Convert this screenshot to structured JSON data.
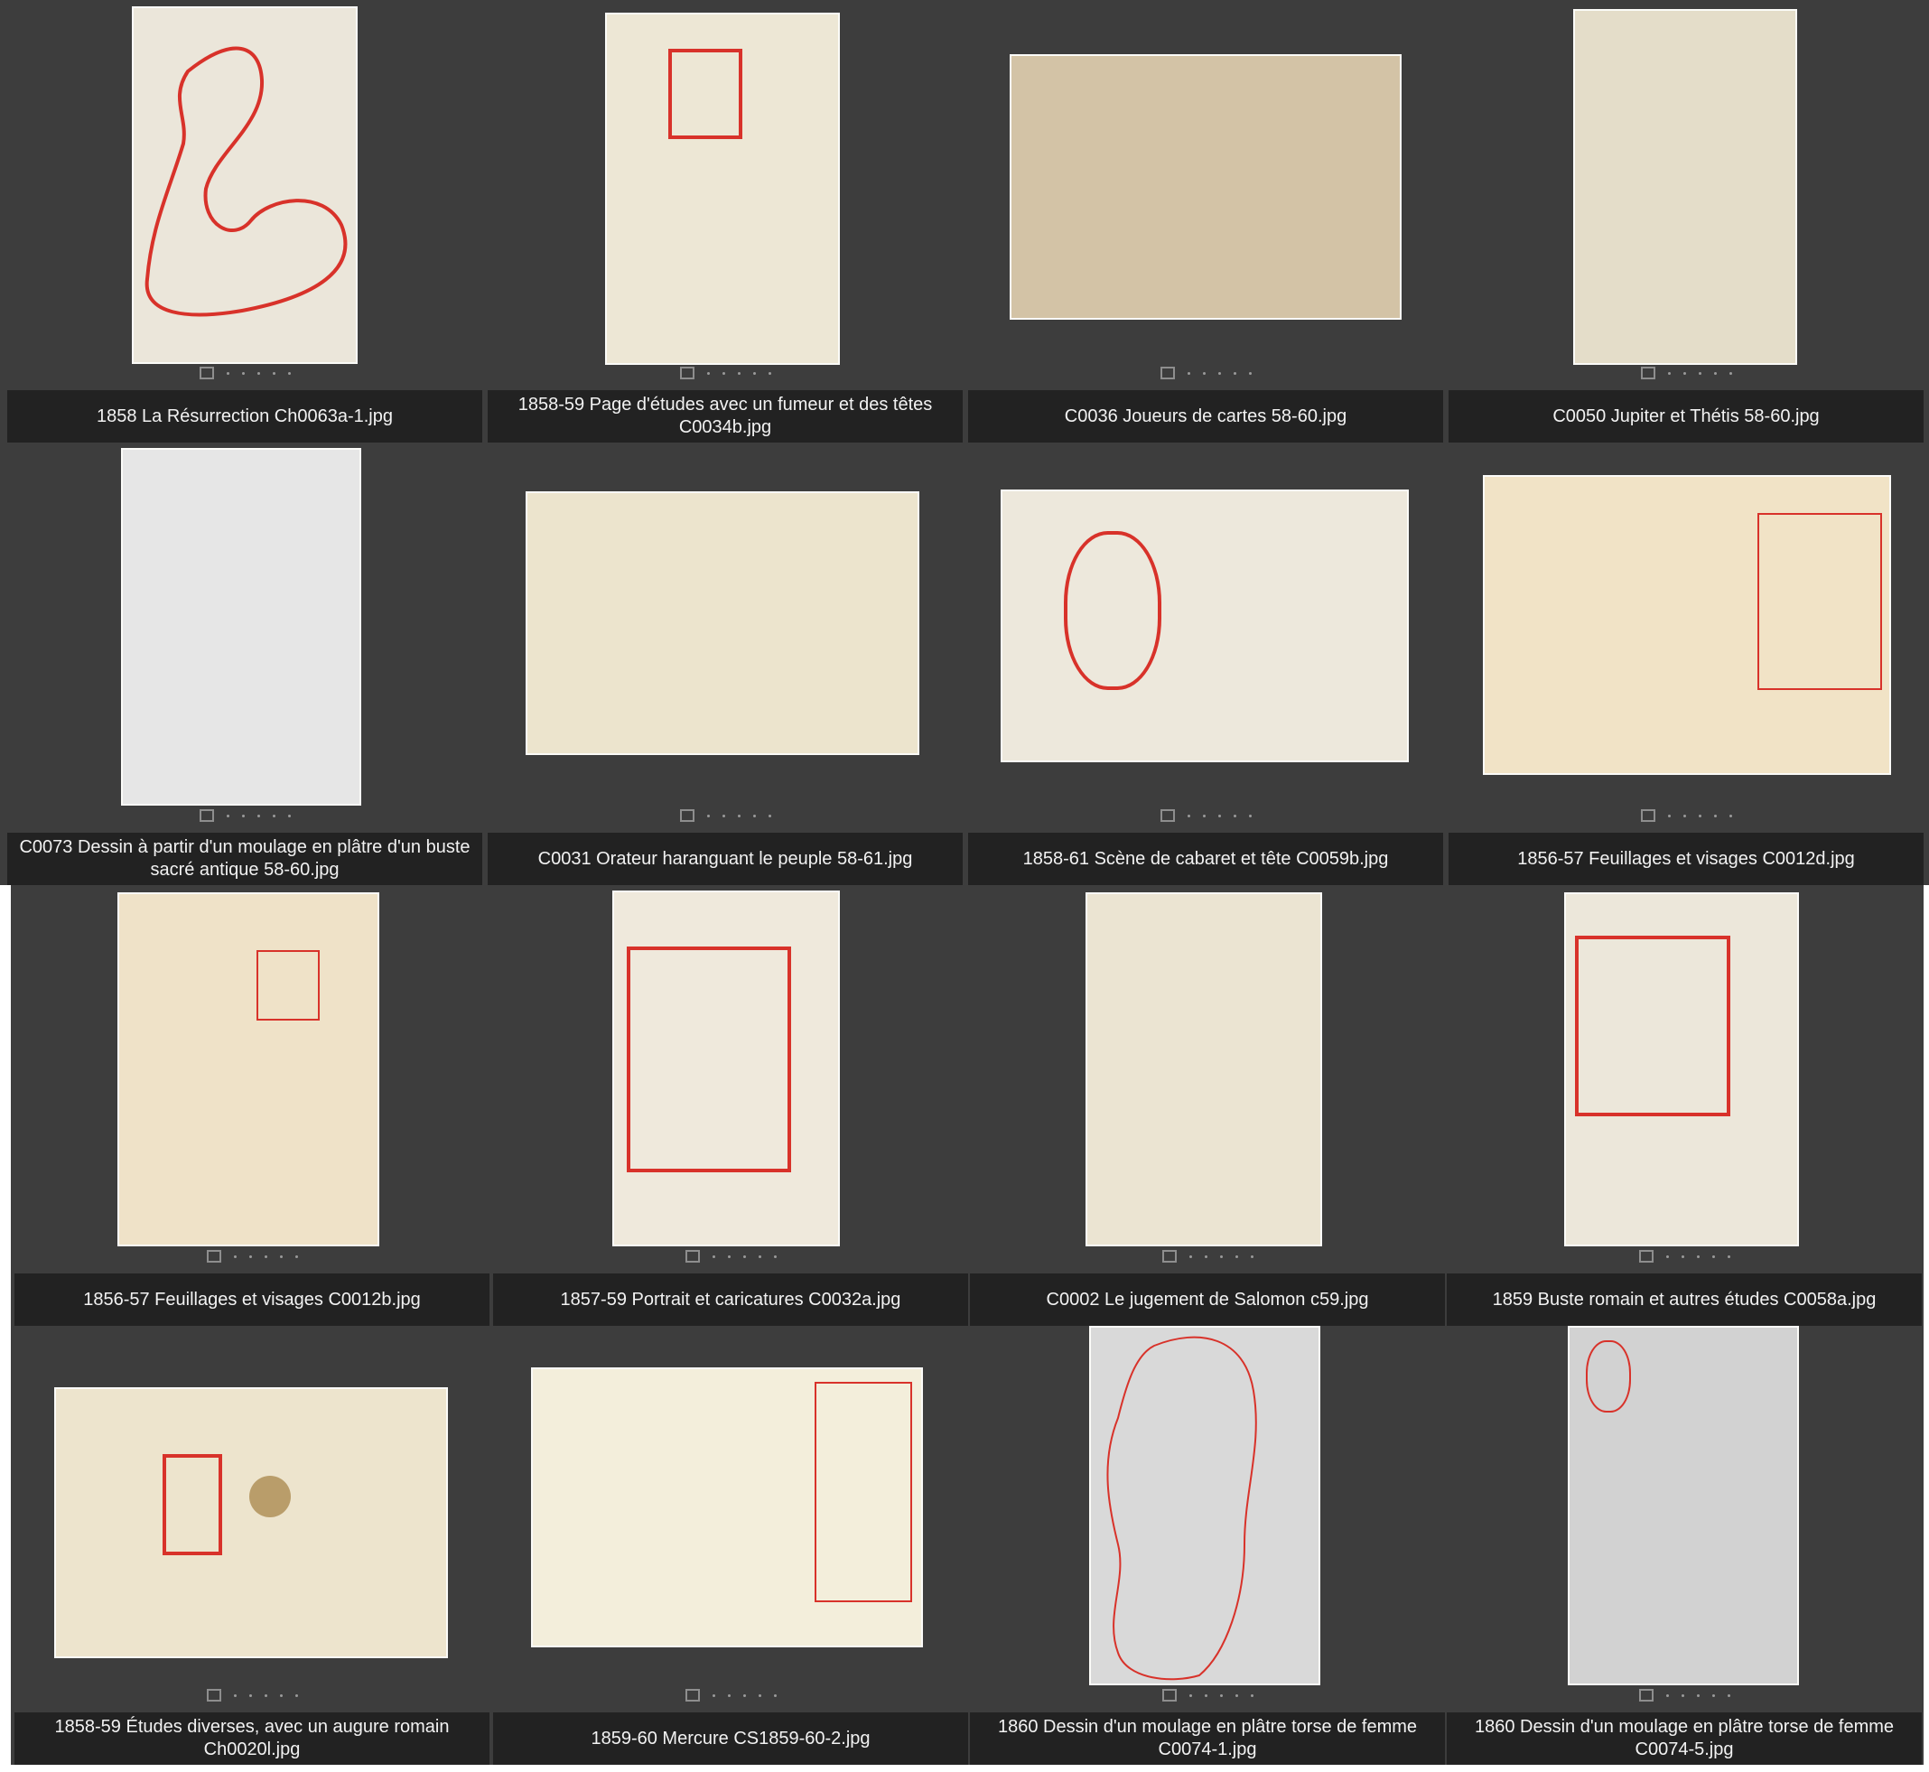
{
  "grid": {
    "items": [
      {
        "label": "1858 La Résurrection Ch0063a-1.jpg",
        "tone": "#ebe6da"
      },
      {
        "label": "1858-59 Page d'études avec un fumeur et des têtes C0034b.jpg",
        "tone": "#ede7d5"
      },
      {
        "label": "C0036 Joueurs de cartes 58-60.jpg",
        "tone": "#d3c3a6"
      },
      {
        "label": "C0050 Jupiter et Thétis 58-60.jpg",
        "tone": "#e4ddc9"
      },
      {
        "label": "C0073 Dessin à partir d'un moulage en plâtre d'un buste sacré antique 58-60.jpg",
        "tone": "#e6e6e6"
      },
      {
        "label": "C0031 Orateur haranguant le peuple 58-61.jpg",
        "tone": "#ece4cd"
      },
      {
        "label": "1858-61 Scène de cabaret et tête C0059b.jpg",
        "tone": "#ede8dc"
      },
      {
        "label": "1856-57 Feuillages et visages C0012d.jpg",
        "tone": "#f1e3c6"
      },
      {
        "label": "1856-57 Feuillages et visages C0012b.jpg",
        "tone": "#efe2c8"
      },
      {
        "label": "1857-59 Portrait et caricatures C0032a.jpg",
        "tone": "#efe9dc"
      },
      {
        "label": "C0002 Le jugement de Salomon c59.jpg",
        "tone": "#ebe4d2"
      },
      {
        "label": "1859 Buste romain et autres études C0058a.jpg",
        "tone": "#ece7da"
      },
      {
        "label": "1858-59 Études diverses, avec un augure romain Ch0020l.jpg",
        "tone": "#ede4cd"
      },
      {
        "label": "1859-60 Mercure CS1859-60-2.jpg",
        "tone": "#f3eedb"
      },
      {
        "label": "1860 Dessin d'un moulage en plâtre torse de femme C0074-1.jpg",
        "tone": "#d9d9d9"
      },
      {
        "label": "1860 Dessin d'un moulage en plâtre torse de femme C0074-5.jpg",
        "tone": "#d2d2d2"
      }
    ]
  }
}
